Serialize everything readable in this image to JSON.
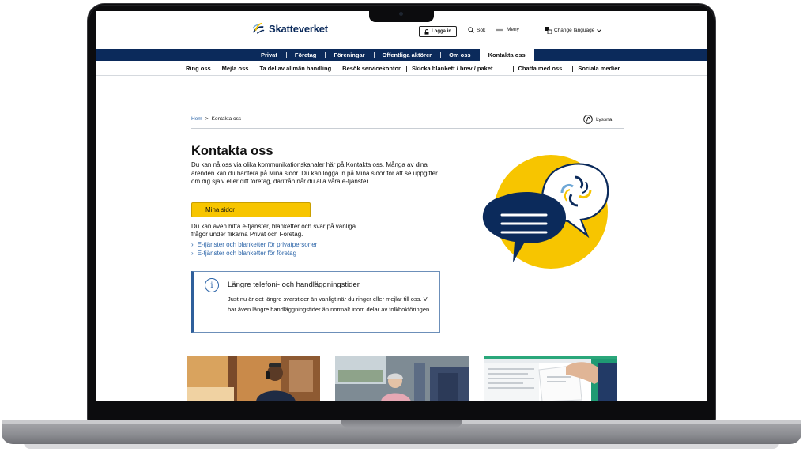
{
  "header": {
    "logo_text": "Skatteverket",
    "login_label": "Logga in",
    "search_label": "Sök",
    "menu_label": "Meny",
    "language_label": "Change language"
  },
  "main_nav": {
    "items": [
      {
        "label": "Privat"
      },
      {
        "label": "Företag"
      },
      {
        "label": "Föreningar"
      },
      {
        "label": "Offentliga aktörer"
      },
      {
        "label": "Om oss"
      },
      {
        "label": "Kontakta oss"
      }
    ]
  },
  "sub_nav": {
    "items": [
      {
        "label": "Ring oss"
      },
      {
        "label": "Mejla oss"
      },
      {
        "label": "Ta del av allmän handling"
      },
      {
        "label": "Besök servicekontor"
      },
      {
        "label": "Skicka blankett / brev / paket"
      },
      {
        "label": "Chatta med oss"
      },
      {
        "label": "Sociala medier"
      }
    ]
  },
  "breadcrumb": {
    "home": "Hem",
    "separator": ">",
    "current": "Kontakta oss"
  },
  "listen_label": "Lyssna",
  "page": {
    "title": "Kontakta oss",
    "intro": "Du kan nå oss via olika kommunikationskanaler här på Kontakta oss. Många av dina ärenden kan du hantera på Mina sidor. Du kan logga in på Mina sidor för att se uppgifter om dig själv eller ditt företag, därifrån når du alla våra e-tjänster.",
    "cta_label": "Mina sidor",
    "more_text": "Du kan även hitta e-tjänster, blanketter och svar på vanliga frågor under flikarna Privat och Företag.",
    "links": [
      {
        "label": "E-tjänster och blanketter för privatpersoner"
      },
      {
        "label": "E-tjänster och blanketter för företag"
      }
    ]
  },
  "notice": {
    "icon": "info-icon",
    "title": "Längre telefoni- och handläggningstider",
    "body": "Just nu är det längre svarstider än vanligt när du ringer eller mejlar till oss. Vi har även längre handläggningstider än normalt inom delar av folkbokföringen."
  },
  "colors": {
    "navy": "#0b2a5b",
    "yellow": "#f7c500",
    "link": "#2b64a8"
  }
}
